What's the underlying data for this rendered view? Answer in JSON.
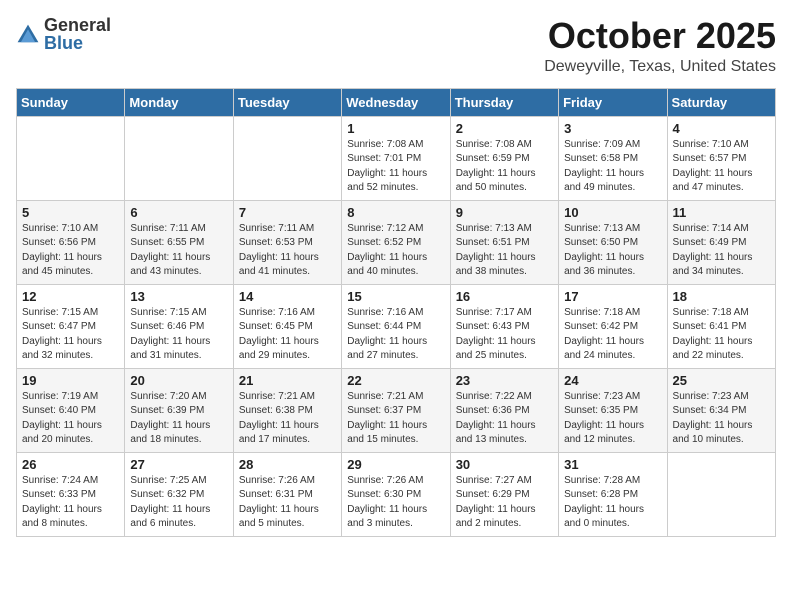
{
  "header": {
    "logo_general": "General",
    "logo_blue": "Blue",
    "title": "October 2025",
    "subtitle": "Deweyville, Texas, United States"
  },
  "calendar": {
    "columns": [
      "Sunday",
      "Monday",
      "Tuesday",
      "Wednesday",
      "Thursday",
      "Friday",
      "Saturday"
    ],
    "rows": [
      [
        {
          "day": "",
          "info": ""
        },
        {
          "day": "",
          "info": ""
        },
        {
          "day": "",
          "info": ""
        },
        {
          "day": "1",
          "info": "Sunrise: 7:08 AM\nSunset: 7:01 PM\nDaylight: 11 hours\nand 52 minutes."
        },
        {
          "day": "2",
          "info": "Sunrise: 7:08 AM\nSunset: 6:59 PM\nDaylight: 11 hours\nand 50 minutes."
        },
        {
          "day": "3",
          "info": "Sunrise: 7:09 AM\nSunset: 6:58 PM\nDaylight: 11 hours\nand 49 minutes."
        },
        {
          "day": "4",
          "info": "Sunrise: 7:10 AM\nSunset: 6:57 PM\nDaylight: 11 hours\nand 47 minutes."
        }
      ],
      [
        {
          "day": "5",
          "info": "Sunrise: 7:10 AM\nSunset: 6:56 PM\nDaylight: 11 hours\nand 45 minutes."
        },
        {
          "day": "6",
          "info": "Sunrise: 7:11 AM\nSunset: 6:55 PM\nDaylight: 11 hours\nand 43 minutes."
        },
        {
          "day": "7",
          "info": "Sunrise: 7:11 AM\nSunset: 6:53 PM\nDaylight: 11 hours\nand 41 minutes."
        },
        {
          "day": "8",
          "info": "Sunrise: 7:12 AM\nSunset: 6:52 PM\nDaylight: 11 hours\nand 40 minutes."
        },
        {
          "day": "9",
          "info": "Sunrise: 7:13 AM\nSunset: 6:51 PM\nDaylight: 11 hours\nand 38 minutes."
        },
        {
          "day": "10",
          "info": "Sunrise: 7:13 AM\nSunset: 6:50 PM\nDaylight: 11 hours\nand 36 minutes."
        },
        {
          "day": "11",
          "info": "Sunrise: 7:14 AM\nSunset: 6:49 PM\nDaylight: 11 hours\nand 34 minutes."
        }
      ],
      [
        {
          "day": "12",
          "info": "Sunrise: 7:15 AM\nSunset: 6:47 PM\nDaylight: 11 hours\nand 32 minutes."
        },
        {
          "day": "13",
          "info": "Sunrise: 7:15 AM\nSunset: 6:46 PM\nDaylight: 11 hours\nand 31 minutes."
        },
        {
          "day": "14",
          "info": "Sunrise: 7:16 AM\nSunset: 6:45 PM\nDaylight: 11 hours\nand 29 minutes."
        },
        {
          "day": "15",
          "info": "Sunrise: 7:16 AM\nSunset: 6:44 PM\nDaylight: 11 hours\nand 27 minutes."
        },
        {
          "day": "16",
          "info": "Sunrise: 7:17 AM\nSunset: 6:43 PM\nDaylight: 11 hours\nand 25 minutes."
        },
        {
          "day": "17",
          "info": "Sunrise: 7:18 AM\nSunset: 6:42 PM\nDaylight: 11 hours\nand 24 minutes."
        },
        {
          "day": "18",
          "info": "Sunrise: 7:18 AM\nSunset: 6:41 PM\nDaylight: 11 hours\nand 22 minutes."
        }
      ],
      [
        {
          "day": "19",
          "info": "Sunrise: 7:19 AM\nSunset: 6:40 PM\nDaylight: 11 hours\nand 20 minutes."
        },
        {
          "day": "20",
          "info": "Sunrise: 7:20 AM\nSunset: 6:39 PM\nDaylight: 11 hours\nand 18 minutes."
        },
        {
          "day": "21",
          "info": "Sunrise: 7:21 AM\nSunset: 6:38 PM\nDaylight: 11 hours\nand 17 minutes."
        },
        {
          "day": "22",
          "info": "Sunrise: 7:21 AM\nSunset: 6:37 PM\nDaylight: 11 hours\nand 15 minutes."
        },
        {
          "day": "23",
          "info": "Sunrise: 7:22 AM\nSunset: 6:36 PM\nDaylight: 11 hours\nand 13 minutes."
        },
        {
          "day": "24",
          "info": "Sunrise: 7:23 AM\nSunset: 6:35 PM\nDaylight: 11 hours\nand 12 minutes."
        },
        {
          "day": "25",
          "info": "Sunrise: 7:23 AM\nSunset: 6:34 PM\nDaylight: 11 hours\nand 10 minutes."
        }
      ],
      [
        {
          "day": "26",
          "info": "Sunrise: 7:24 AM\nSunset: 6:33 PM\nDaylight: 11 hours\nand 8 minutes."
        },
        {
          "day": "27",
          "info": "Sunrise: 7:25 AM\nSunset: 6:32 PM\nDaylight: 11 hours\nand 6 minutes."
        },
        {
          "day": "28",
          "info": "Sunrise: 7:26 AM\nSunset: 6:31 PM\nDaylight: 11 hours\nand 5 minutes."
        },
        {
          "day": "29",
          "info": "Sunrise: 7:26 AM\nSunset: 6:30 PM\nDaylight: 11 hours\nand 3 minutes."
        },
        {
          "day": "30",
          "info": "Sunrise: 7:27 AM\nSunset: 6:29 PM\nDaylight: 11 hours\nand 2 minutes."
        },
        {
          "day": "31",
          "info": "Sunrise: 7:28 AM\nSunset: 6:28 PM\nDaylight: 11 hours\nand 0 minutes."
        },
        {
          "day": "",
          "info": ""
        }
      ]
    ]
  }
}
